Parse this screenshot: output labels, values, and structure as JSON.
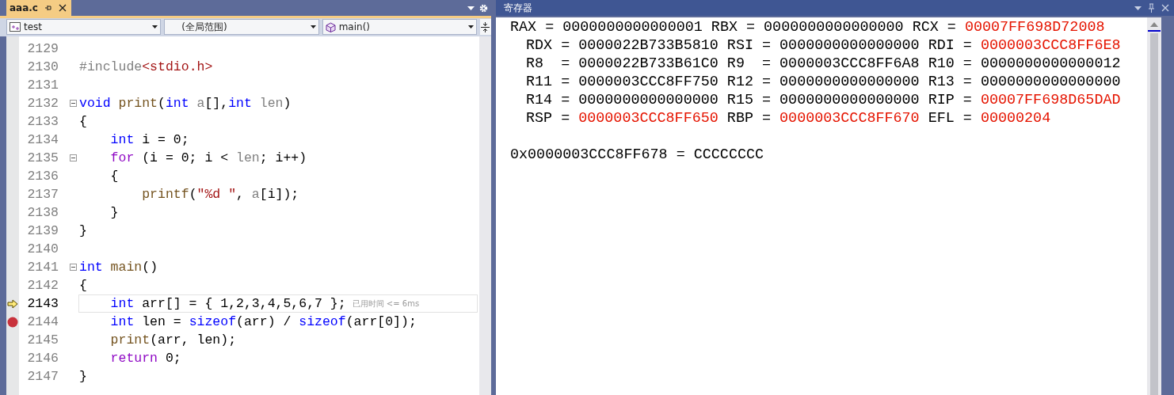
{
  "editor": {
    "tab": {
      "label": "aaa.c",
      "selected": true
    },
    "nav": [
      {
        "label": "test",
        "kind": "project"
      },
      {
        "label": "(全局范围)",
        "kind": "scope"
      },
      {
        "label": "main()",
        "kind": "method"
      }
    ],
    "lines": [
      {
        "number": "2129",
        "foldable": false,
        "current": false,
        "breakpoint": false
      },
      {
        "number": "2130",
        "tokens": [
          {
            "text": "#include",
            "kind": "pp"
          },
          {
            "text": "<stdio.h>",
            "kind": "str"
          }
        ],
        "foldable": false,
        "current": false,
        "breakpoint": false
      },
      {
        "number": "2131",
        "foldable": false,
        "current": false,
        "breakpoint": false
      },
      {
        "number": "2132",
        "tokens": [
          {
            "text": "void",
            "kind": "kw"
          },
          {
            "text": " print",
            "kind": "fn"
          },
          {
            "text": "(",
            "kind": "plain"
          },
          {
            "text": "int",
            "kind": "kw"
          },
          {
            "text": " a",
            "kind": "param"
          },
          {
            "text": "[],",
            "kind": "plain"
          },
          {
            "text": "int",
            "kind": "kw"
          },
          {
            "text": " len",
            "kind": "param"
          },
          {
            "text": ")",
            "kind": "plain"
          }
        ],
        "foldable": true,
        "current": false,
        "breakpoint": false
      },
      {
        "number": "2133",
        "tokens": [
          {
            "text": "{",
            "kind": "plain"
          }
        ],
        "foldable": false,
        "current": false,
        "breakpoint": false
      },
      {
        "number": "2134",
        "tokens": [
          {
            "text": "    int",
            "kind": "kw"
          },
          {
            "text": " i = 0;",
            "kind": "plain"
          }
        ],
        "foldable": false,
        "current": false,
        "breakpoint": false
      },
      {
        "number": "2135",
        "tokens": [
          {
            "text": "    for",
            "kind": "ctl"
          },
          {
            "text": " (i = 0; i < ",
            "kind": "plain"
          },
          {
            "text": "len",
            "kind": "param"
          },
          {
            "text": "; i++)",
            "kind": "plain"
          }
        ],
        "foldable": true,
        "current": false,
        "breakpoint": false
      },
      {
        "number": "2136",
        "tokens": [
          {
            "text": "    {",
            "kind": "plain"
          }
        ],
        "foldable": false,
        "current": false,
        "breakpoint": false
      },
      {
        "number": "2137",
        "tokens": [
          {
            "text": "        printf",
            "kind": "fn"
          },
          {
            "text": "(",
            "kind": "plain"
          },
          {
            "text": "\"%d \"",
            "kind": "str"
          },
          {
            "text": ", ",
            "kind": "plain"
          },
          {
            "text": "a",
            "kind": "param"
          },
          {
            "text": "[i]);",
            "kind": "plain"
          }
        ],
        "foldable": false,
        "current": false,
        "breakpoint": false
      },
      {
        "number": "2138",
        "tokens": [
          {
            "text": "    }",
            "kind": "plain"
          }
        ],
        "foldable": false,
        "current": false,
        "breakpoint": false
      },
      {
        "number": "2139",
        "tokens": [
          {
            "text": "}",
            "kind": "plain"
          }
        ],
        "foldable": false,
        "current": false,
        "breakpoint": false
      },
      {
        "number": "2140",
        "foldable": false,
        "current": false,
        "breakpoint": false
      },
      {
        "number": "2141",
        "tokens": [
          {
            "text": "int",
            "kind": "kw"
          },
          {
            "text": " main",
            "kind": "fn"
          },
          {
            "text": "()",
            "kind": "plain"
          }
        ],
        "foldable": true,
        "current": false,
        "breakpoint": false
      },
      {
        "number": "2142",
        "tokens": [
          {
            "text": "{",
            "kind": "plain"
          }
        ],
        "foldable": false,
        "current": false,
        "breakpoint": false
      },
      {
        "number": "2143",
        "tokens": [
          {
            "text": "    int",
            "kind": "kw"
          },
          {
            "text": " arr[] = { 1,2,3,4,5,6,7 };",
            "kind": "plain"
          }
        ],
        "hint": "已用时间 <= 6ms",
        "foldable": false,
        "current": true,
        "breakpoint": false
      },
      {
        "number": "2144",
        "tokens": [
          {
            "text": "    int",
            "kind": "kw"
          },
          {
            "text": " len = ",
            "kind": "plain"
          },
          {
            "text": "sizeof",
            "kind": "kw"
          },
          {
            "text": "(arr) / ",
            "kind": "plain"
          },
          {
            "text": "sizeof",
            "kind": "kw"
          },
          {
            "text": "(arr[0]);",
            "kind": "plain"
          }
        ],
        "foldable": false,
        "current": false,
        "breakpoint": true
      },
      {
        "number": "2145",
        "tokens": [
          {
            "text": "    print",
            "kind": "fn"
          },
          {
            "text": "(arr, len);",
            "kind": "plain"
          }
        ],
        "foldable": false,
        "current": false,
        "breakpoint": false
      },
      {
        "number": "2146",
        "tokens": [
          {
            "text": "    return",
            "kind": "ctl"
          },
          {
            "text": " 0;",
            "kind": "plain"
          }
        ],
        "foldable": false,
        "current": false,
        "breakpoint": false
      },
      {
        "number": "2147",
        "tokens": [
          {
            "text": "}",
            "kind": "plain"
          }
        ],
        "foldable": false,
        "current": false,
        "breakpoint": false
      }
    ]
  },
  "registers": {
    "title": "寄存器",
    "rows": [
      [
        {
          "name": "RAX =",
          "value": "0000000000000001",
          "changed": false
        },
        {
          "name": "RBX =",
          "value": "0000000000000000",
          "changed": false
        },
        {
          "name": "RCX =",
          "value": "00007FF698D72008",
          "changed": true
        }
      ],
      [
        {
          "name": "RDX =",
          "value": "0000022B733B5810",
          "changed": false
        },
        {
          "name": "RSI =",
          "value": "0000000000000000",
          "changed": false
        },
        {
          "name": "RDI =",
          "value": "0000003CCC8FF6E8",
          "changed": true
        }
      ],
      [
        {
          "name": "R8  =",
          "value": "0000022B733B61C0",
          "changed": false
        },
        {
          "name": "R9  =",
          "value": "0000003CCC8FF6A8",
          "changed": false
        },
        {
          "name": "R10 =",
          "value": "0000000000000012",
          "changed": false
        }
      ],
      [
        {
          "name": "R11 =",
          "value": "0000003CCC8FF750",
          "changed": false
        },
        {
          "name": "R12 =",
          "value": "0000000000000000",
          "changed": false
        },
        {
          "name": "R13 =",
          "value": "0000000000000000",
          "changed": false
        }
      ],
      [
        {
          "name": "R14 =",
          "value": "0000000000000000",
          "changed": false
        },
        {
          "name": "R15 =",
          "value": "0000000000000000",
          "changed": false
        },
        {
          "name": "RIP =",
          "value": "00007FF698D65DAD",
          "changed": true
        }
      ],
      [
        {
          "name": "RSP =",
          "value": "0000003CCC8FF650",
          "changed": true
        },
        {
          "name": "RBP =",
          "value": "0000003CCC8FF670",
          "changed": true
        },
        {
          "name": "EFL =",
          "value": "00000204",
          "changed": true
        }
      ]
    ],
    "memory": "0x0000003CCC8FF678 = CCCCCCCC"
  }
}
